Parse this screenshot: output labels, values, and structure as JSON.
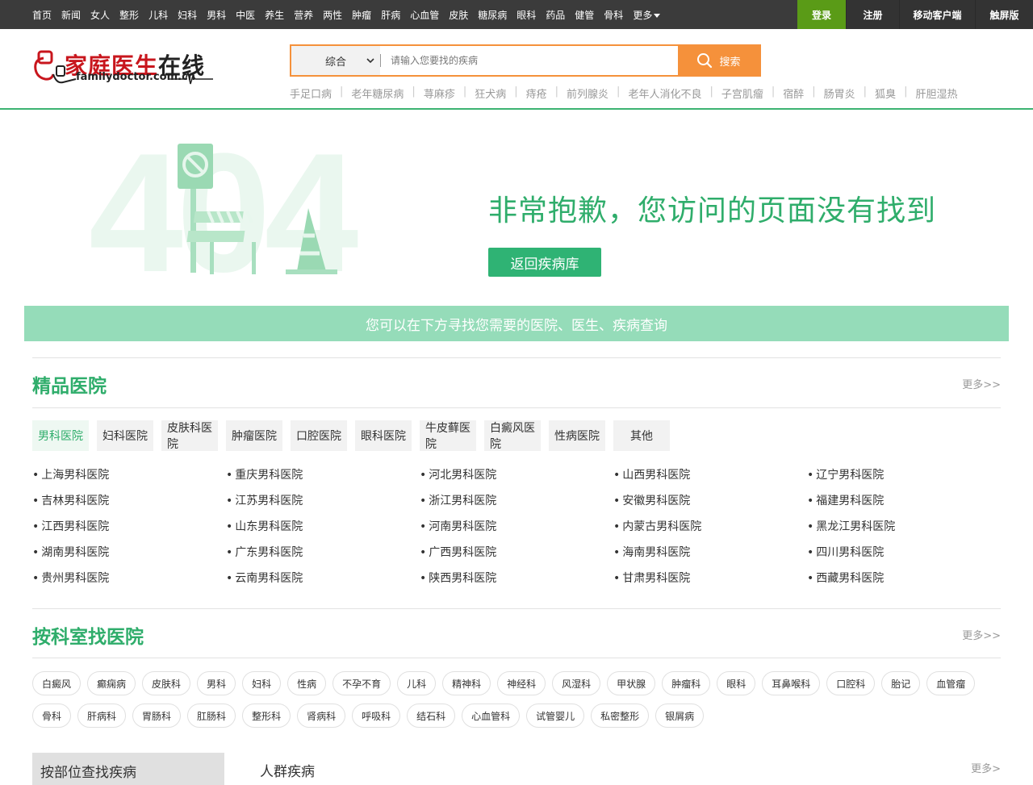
{
  "topnav": {
    "items": [
      "首页",
      "新闻",
      "女人",
      "整形",
      "儿科",
      "妇科",
      "男科",
      "中医",
      "养生",
      "营养",
      "两性",
      "肿瘤",
      "肝病",
      "心血管",
      "皮肤",
      "糖尿病",
      "眼科",
      "药品",
      "健管",
      "骨科"
    ],
    "more": "更多"
  },
  "account": {
    "login": "登录",
    "register": "注册",
    "mobile": "移动客户端",
    "touch": "触屏版"
  },
  "logo": {
    "brand_part1": "家庭医生",
    "brand_part2": "在线",
    "url": "familydoctor.com.cn"
  },
  "search": {
    "category": "综合",
    "placeholder": "请输入您要找的疾病",
    "button": "搜索"
  },
  "hotwords": [
    "手足口病",
    "老年糖尿病",
    "荨麻疹",
    "狂犬病",
    "痔疮",
    "前列腺炎",
    "老年人消化不良",
    "子宫肌瘤",
    "宿醉",
    "肠胃炎",
    "狐臭",
    "肝胆湿热"
  ],
  "error": {
    "big_text": "404",
    "message": "非常抱歉，您访问的页面没有找到",
    "back_button": "返回疾病库"
  },
  "banner": "您可以在下方寻找您需要的医院、医生、疾病查询",
  "premium": {
    "title": "精品医院",
    "more": "更多>>",
    "tabs": [
      "男科医院",
      "妇科医院",
      "皮肤科医院",
      "肿瘤医院",
      "口腔医院",
      "眼科医院",
      "牛皮藓医院",
      "白癜风医院",
      "性病医院",
      "其他"
    ],
    "hospitals": [
      "上海男科医院",
      "重庆男科医院",
      "河北男科医院",
      "山西男科医院",
      "辽宁男科医院",
      "吉林男科医院",
      "江苏男科医院",
      "浙江男科医院",
      "安徽男科医院",
      "福建男科医院",
      "江西男科医院",
      "山东男科医院",
      "河南男科医院",
      "内蒙古男科医院",
      "黑龙江男科医院",
      "湖南男科医院",
      "广东男科医院",
      "广西男科医院",
      "海南男科医院",
      "四川男科医院",
      "贵州男科医院",
      "云南男科医院",
      "陕西男科医院",
      "甘肃男科医院",
      "西藏男科医院"
    ]
  },
  "departments": {
    "title": "按科室找医院",
    "more": "更多>>",
    "items": [
      "白癜风",
      "癫痫病",
      "皮肤科",
      "男科",
      "妇科",
      "性病",
      "不孕不育",
      "儿科",
      "精神科",
      "神经科",
      "风湿科",
      "甲状腺",
      "肿瘤科",
      "眼科",
      "耳鼻喉科",
      "口腔科",
      "胎记",
      "血管瘤",
      "骨科",
      "肝病科",
      "胃肠科",
      "肛肠科",
      "整形科",
      "肾病科",
      "呼吸科",
      "结石科",
      "心血管科",
      "试管婴儿",
      "私密整形",
      "银屑病"
    ]
  },
  "bottom": {
    "bodypart_title": "按部位查找疾病",
    "crowd_title": "人群疾病",
    "more": "更多>"
  }
}
